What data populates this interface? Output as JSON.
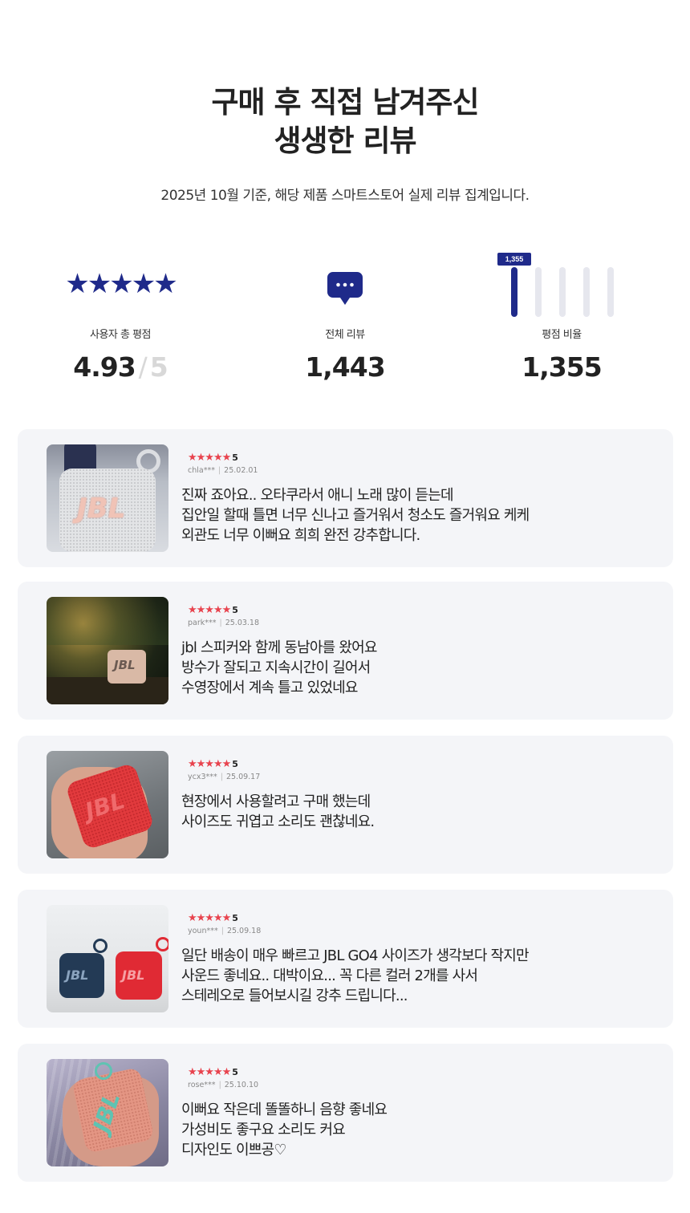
{
  "header": {
    "title_line1": "구매 후 직접 남겨주신",
    "title_line2": "생생한 리뷰",
    "subtitle": "2025년 10월 기준, 해당 제품 스마트스토어 실제 리뷰 집계입니다."
  },
  "stats": {
    "rating": {
      "icon": "star-icon",
      "stars": "★★★★★",
      "label": "사용자 총 평점",
      "value": "4.93",
      "max": "5",
      "color": "#1f2a8a"
    },
    "reviews": {
      "icon": "chat-bubble-icon",
      "label": "전체 리뷰",
      "value": "1,443"
    },
    "ratio": {
      "icon": "bar-chart-icon",
      "label": "평점 비율",
      "value": "1,355",
      "tag": "1,355"
    }
  },
  "reviews": [
    {
      "stars": "★★★★★",
      "score": "5",
      "user": "chla***",
      "date": "25.02.01",
      "lines": [
        "진짜 죠아요.. 오타쿠라서 애니 노래 많이 듣는데",
        "집안일 할때 틀면 너무 신나고 즐거워서 청소도 즐거워요 케케",
        "외관도 너무 이뻐요 희희 완전 강추합니다."
      ],
      "photo_label": "JBL"
    },
    {
      "stars": "★★★★★",
      "score": "5",
      "user": "park***",
      "date": "25.03.18",
      "lines": [
        "jbl 스피커와 함께 동남아를 왔어요",
        "방수가 잘되고 지속시간이 길어서",
        "수영장에서 계속 틀고 있었네요"
      ],
      "photo_label": "JBL"
    },
    {
      "stars": "★★★★★",
      "score": "5",
      "user": "ycx3***",
      "date": "25.09.17",
      "lines": [
        "현장에서 사용할려고 구매 했는데",
        "사이즈도 귀엽고 소리도 괜찮네요."
      ],
      "photo_label": "JBL"
    },
    {
      "stars": "★★★★★",
      "score": "5",
      "user": "youn***",
      "date": "25.09.18",
      "lines": [
        "일단 배송이 매우 빠르고 JBL GO4 사이즈가 생각보다 작지만",
        "사운드 좋네요.. 대박이요... 꼭 다른 컬러 2개를 사서",
        "스테레오로 들어보시길 강추 드립니다..."
      ],
      "photo_label": "JBL"
    },
    {
      "stars": "★★★★★",
      "score": "5",
      "user": "rose***",
      "date": "25.10.10",
      "lines": [
        "이뻐요 작은데 똘똘하니 음향 좋네요",
        "가성비도 좋구요 소리도 커요",
        "디자인도 이쁘공♡"
      ],
      "photo_label": "JBL"
    }
  ],
  "colors": {
    "accent": "#1f2a8a",
    "review_star": "#e8434e",
    "card_bg": "#f4f5f8"
  }
}
